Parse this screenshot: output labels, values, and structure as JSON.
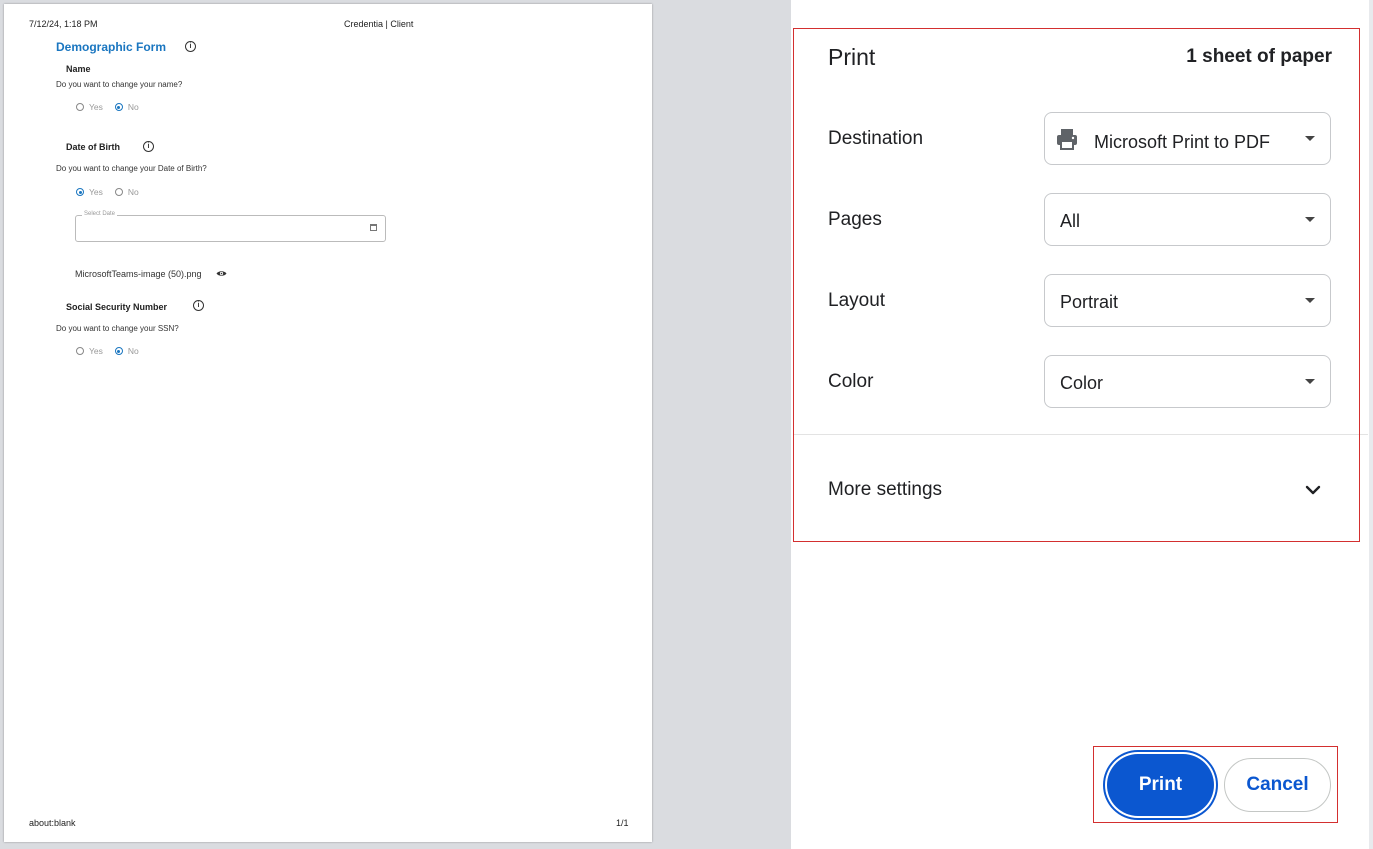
{
  "preview": {
    "header_date": "7/12/24, 1:18 PM",
    "header_site": "Credentia | Client",
    "footer_url": "about:blank",
    "footer_page": "1/1",
    "form_title": "Demographic Form",
    "sections": {
      "name": {
        "title": "Name",
        "question": "Do you want to change your name?",
        "yes_label": "Yes",
        "no_label": "No",
        "selected": "No"
      },
      "dob": {
        "title": "Date of Birth",
        "question": "Do you want to change your Date of Birth?",
        "yes_label": "Yes",
        "no_label": "No",
        "selected": "Yes",
        "date_placeholder": "Select Date",
        "file_name": "MicrosoftTeams-image (50).png"
      },
      "ssn": {
        "title": "Social Security Number",
        "question": "Do you want to change your SSN?",
        "yes_label": "Yes",
        "no_label": "No",
        "selected": "No"
      }
    }
  },
  "panel": {
    "title": "Print",
    "sheet_count": "1 sheet of paper",
    "destination_label": "Destination",
    "destination_value": "Microsoft Print to PDF",
    "pages_label": "Pages",
    "pages_value": "All",
    "layout_label": "Layout",
    "layout_value": "Portrait",
    "color_label": "Color",
    "color_value": "Color",
    "more_settings_label": "More settings",
    "print_button": "Print",
    "cancel_button": "Cancel"
  },
  "colors": {
    "accent": "#0b57d0",
    "form_title": "#1a76c0",
    "highlight": "#d32f2f"
  }
}
